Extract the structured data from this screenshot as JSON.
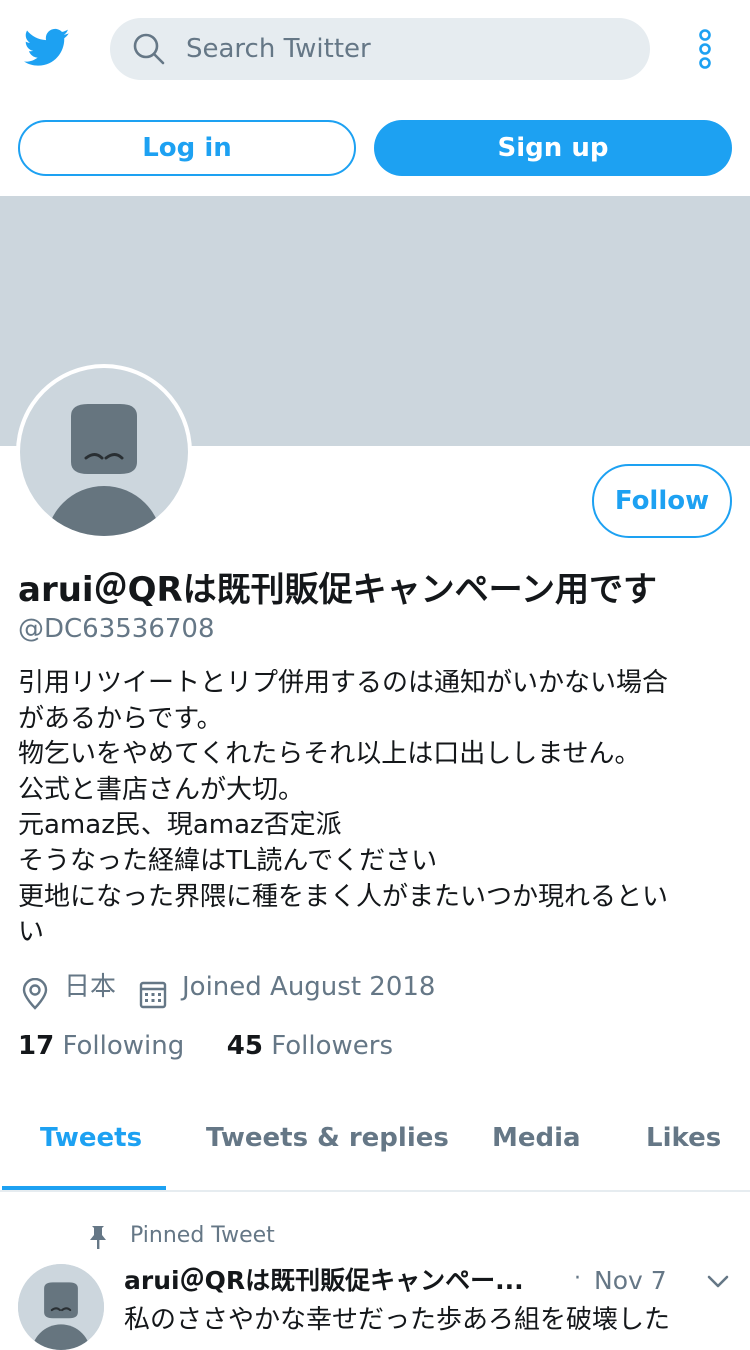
{
  "header": {
    "search_placeholder": "Search Twitter",
    "login_label": "Log in",
    "signup_label": "Sign up"
  },
  "profile": {
    "follow_label": "Follow",
    "name": "arui＠QRは既刊販促キャンペーン用です",
    "handle": "@DC63536708",
    "bio_lines": [
      "引用リツイートとリプ併用するのは通知がいかない場合",
      "があるからです。",
      "物乞いをやめてくれたらそれ以上は口出ししません。",
      "公式と書店さんが大切。",
      "元amaz民、現amaz否定派",
      "そうなった経緯はTL読んでください",
      "更地になった界隈に種をまく人がまたいつか現れるとい",
      "い"
    ],
    "location": "日本",
    "joined": "Joined August 2018",
    "following_count": "17",
    "following_label": "Following",
    "followers_count": "45",
    "followers_label": "Followers"
  },
  "tabs": [
    {
      "label": "Tweets",
      "active": true
    },
    {
      "label": "Tweets & replies",
      "active": false
    },
    {
      "label": "Media",
      "active": false
    },
    {
      "label": "Likes",
      "active": false
    }
  ],
  "pinned_tweet": {
    "pinned_label": "Pinned Tweet",
    "author": "arui＠QRは既刊販促キャンペー...",
    "separator": "·",
    "date": "Nov 7",
    "text": "私のささやかな幸せだった歩あろ組を破壊した"
  },
  "colors": {
    "accent": "#1da1f2",
    "banner": "#ccd6dd",
    "secondary_text": "#657786"
  },
  "icons": [
    "twitter-bird-icon",
    "search-icon",
    "more-options-icon",
    "location-pin-icon",
    "calendar-icon",
    "pin-icon",
    "chevron-down-icon"
  ]
}
